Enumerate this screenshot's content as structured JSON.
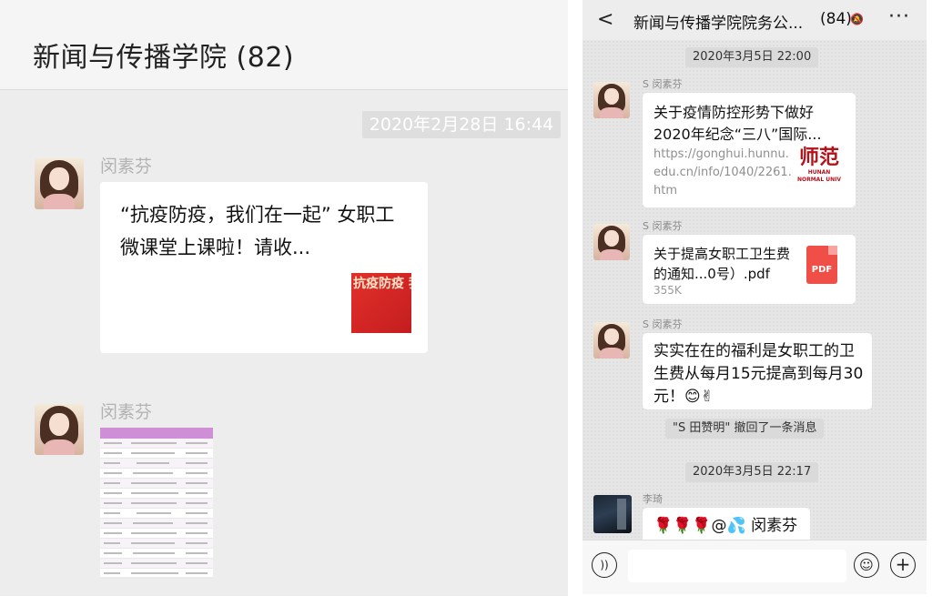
{
  "left": {
    "title": "新闻与传播学院 (82)",
    "timestamp": "2020年2月28日 16:44",
    "messages": [
      {
        "sender": "闵素芬",
        "card_text": "“抗疫防疫，我们在一起” 女职工微课堂上课啦！请收...",
        "thumb_text": "抗疫防疫 我们在一起"
      },
      {
        "sender": "闵素芬"
      }
    ]
  },
  "right": {
    "header": {
      "back": "<",
      "title": "新闻与传播学院院务公...",
      "count": "(84)",
      "more": "···"
    },
    "timestamps": [
      "2020年3月5日 22:00",
      "2020年3月5日 22:17"
    ],
    "messages": [
      {
        "sender": "S 闵素芬",
        "link_title": "关于疫情防控形势下做好2020年纪念“三八”国际...",
        "link_url": "https://gonghui.hunnu.edu.cn/info/1040/2261.htm",
        "logo_text": "师范"
      },
      {
        "sender": "S 闵素芬",
        "file_name": "关于提高女职工卫生费的通知...0号）.pdf",
        "file_size": "355K",
        "file_icon_label": "PDF"
      },
      {
        "sender": "S 闵素芬",
        "text": "实实在在的福利是女职工的卫生费从每月15元提高到每月30元！😊✌"
      },
      {
        "sender": "李琦",
        "text": "🌹🌹🌹@💦 闵素芬"
      }
    ],
    "system_notice": "\"S 田赞明\" 撤回了一条消息",
    "input_placeholder": ""
  },
  "colors": {
    "pdf": "#f04f47",
    "bubble": "#ffffff",
    "chat_bg": "#ededed"
  }
}
